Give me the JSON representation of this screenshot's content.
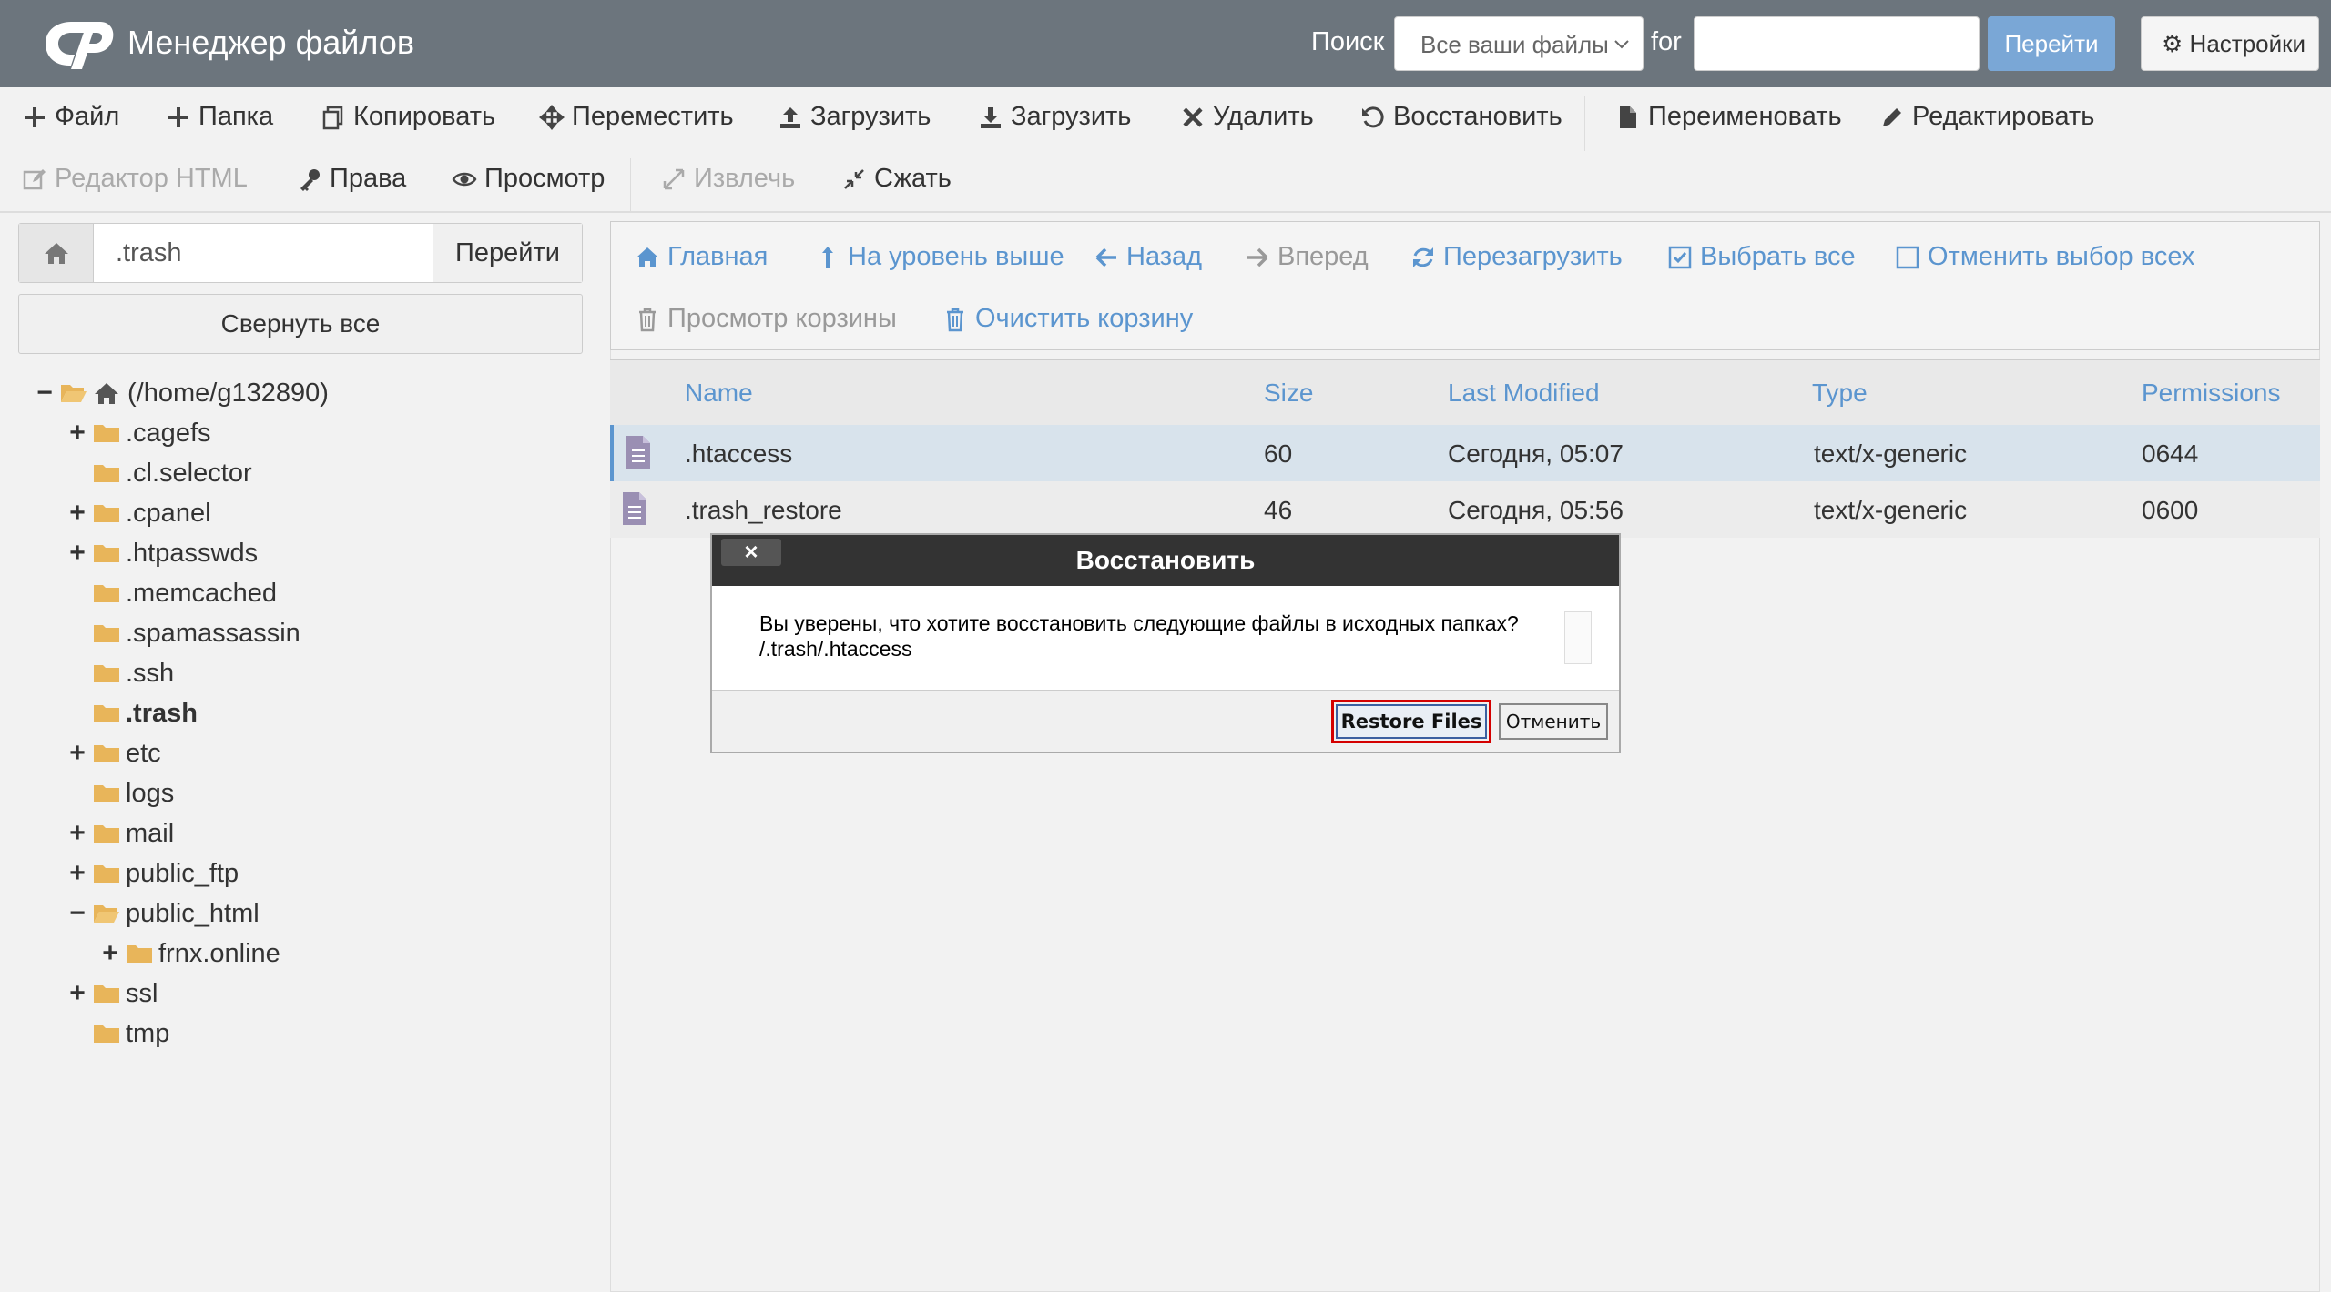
{
  "header": {
    "app_title": "Менеджер файлов",
    "search_label": "Поиск",
    "search_scope": "Все ваши файлы",
    "for_label": "for",
    "search_value": "",
    "go_label": "Перейти",
    "settings_label": "Настройки"
  },
  "toolbar": {
    "file": "Файл",
    "folder": "Папка",
    "copy": "Копировать",
    "move": "Переместить",
    "upload": "Загрузить",
    "download": "Загрузить",
    "delete": "Удалить",
    "restore": "Восстановить",
    "rename": "Переименовать",
    "edit": "Редактировать",
    "html_editor": "Редактор HTML",
    "permissions": "Права",
    "view": "Просмотр",
    "extract": "Извлечь",
    "compress": "Сжать"
  },
  "left": {
    "path_value": ".trash",
    "path_go": "Перейти",
    "collapse_all": "Свернуть все",
    "tree": [
      {
        "label": "(/home/g132890)",
        "toggle": "−"
      },
      {
        "label": ".cagefs",
        "toggle": "+"
      },
      {
        "label": ".cl.selector",
        "toggle": ""
      },
      {
        "label": ".cpanel",
        "toggle": "+"
      },
      {
        "label": ".htpasswds",
        "toggle": "+"
      },
      {
        "label": ".memcached",
        "toggle": ""
      },
      {
        "label": ".spamassassin",
        "toggle": ""
      },
      {
        "label": ".ssh",
        "toggle": ""
      },
      {
        "label": ".trash",
        "toggle": ""
      },
      {
        "label": "etc",
        "toggle": "+"
      },
      {
        "label": "logs",
        "toggle": ""
      },
      {
        "label": "mail",
        "toggle": "+"
      },
      {
        "label": "public_ftp",
        "toggle": "+"
      },
      {
        "label": "public_html",
        "toggle": "−"
      },
      {
        "label": "frnx.online",
        "toggle": "+"
      },
      {
        "label": "ssl",
        "toggle": "+"
      },
      {
        "label": "tmp",
        "toggle": ""
      }
    ]
  },
  "nav": {
    "home": "Главная",
    "up": "На уровень выше",
    "back": "Назад",
    "forward": "Вперед",
    "reload": "Перезагрузить",
    "select_all": "Выбрать все",
    "deselect_all": "Отменить выбор всех",
    "view_trash": "Просмотр корзины",
    "empty_trash": "Очистить корзину"
  },
  "table": {
    "headers": {
      "name": "Name",
      "size": "Size",
      "modified": "Last Modified",
      "type": "Type",
      "perms": "Permissions"
    },
    "rows": [
      {
        "name": ".htaccess",
        "size": "60",
        "modified": "Сегодня, 05:07",
        "type": "text/x-generic",
        "perms": "0644"
      },
      {
        "name": ".trash_restore",
        "size": "46",
        "modified": "Сегодня, 05:56",
        "type": "text/x-generic",
        "perms": "0600"
      }
    ]
  },
  "dialog": {
    "title": "Восстановить",
    "close": "×",
    "message": "Вы уверены, что хотите восстановить следующие файлы в исходных папках?",
    "file": "/.trash/.htaccess",
    "restore_label": "Restore Files",
    "cancel_label": "Отменить"
  },
  "colors": {
    "header_bg": "#6c757d",
    "link_blue": "#5b95cf",
    "dialog_title_bg": "#333333",
    "highlight_red": "#d40000"
  }
}
